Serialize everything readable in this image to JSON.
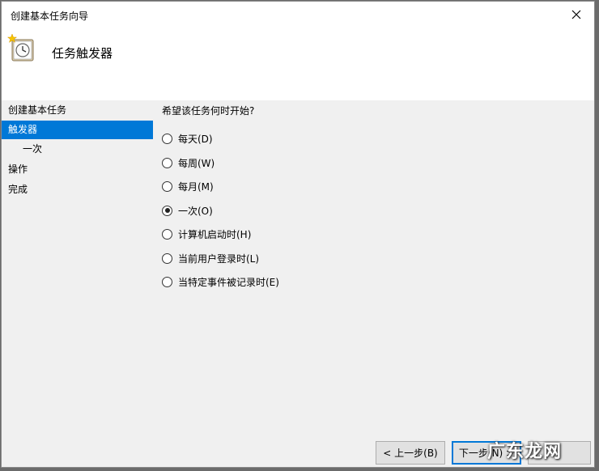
{
  "window": {
    "title": "创建基本任务向导",
    "close_glyph": "✕"
  },
  "header": {
    "title": "任务触发器",
    "icon": "task-clock-icon"
  },
  "sidebar": {
    "items": [
      {
        "label": "创建基本任务",
        "selected": false
      },
      {
        "label": "触发器",
        "selected": true
      },
      {
        "label": "一次",
        "selected": false
      },
      {
        "label": "操作",
        "selected": false
      },
      {
        "label": "完成",
        "selected": false
      }
    ]
  },
  "content": {
    "question": "希望该任务何时开始?",
    "options": [
      {
        "label": "每天(D)",
        "checked": false
      },
      {
        "label": "每周(W)",
        "checked": false
      },
      {
        "label": "每月(M)",
        "checked": false
      },
      {
        "label": "一次(O)",
        "checked": true
      },
      {
        "label": "计算机启动时(H)",
        "checked": false
      },
      {
        "label": "当前用户登录时(L)",
        "checked": false
      },
      {
        "label": "当特定事件被记录时(E)",
        "checked": false
      }
    ]
  },
  "buttons": {
    "back": "< 上一步(B)",
    "next": "下一步(N) >",
    "cancel": ""
  },
  "watermark": {
    "text": "广东龙网"
  }
}
